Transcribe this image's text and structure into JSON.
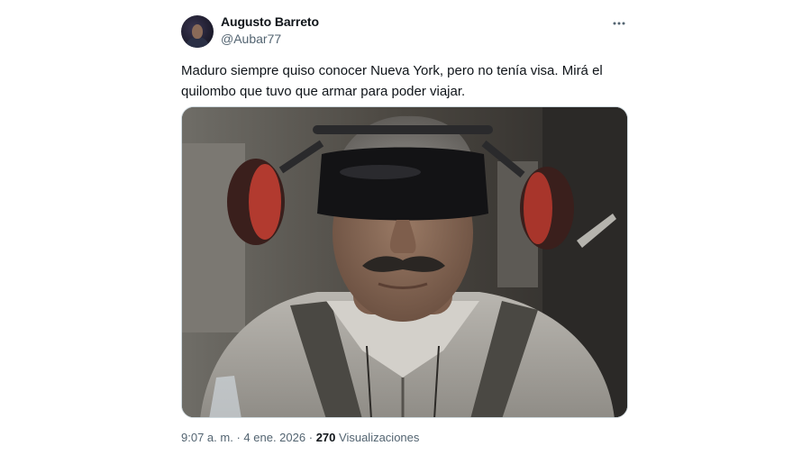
{
  "author": {
    "display_name": "Augusto Barreto",
    "handle": "@Aubar77",
    "avatar_icon": "profile-avatar"
  },
  "tweet": {
    "text": "Maduro siempre quiso conocer Nueva York, pero no tenía visa. Mirá el quilombo que tuvo que armar para poder viajar.",
    "more_icon": "more-horizontal-icon"
  },
  "media": {
    "alt": "Hombre con bigote, antifaz oscuro sobre los ojos y protectores auditivos rojos, vestido con buzo gris, sentado en el interior de un vehículo."
  },
  "meta": {
    "time": "9:07 a. m.",
    "separator": "·",
    "date": "4 ene. 2026",
    "views_count": "270",
    "views_label": "Visualizaciones"
  },
  "colors": {
    "text_primary": "#0f1419",
    "text_secondary": "#536471",
    "border": "#cfd9de",
    "background": "#ffffff"
  }
}
